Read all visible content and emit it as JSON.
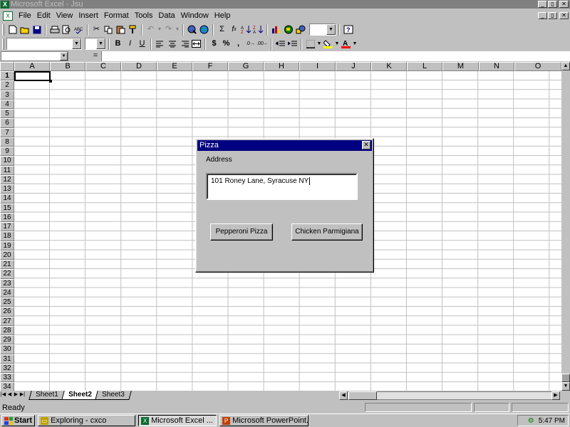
{
  "window": {
    "title": "Microsoft Excel - Jsu",
    "min_glyph": "_",
    "max_glyph": "▯",
    "close_glyph": "✕"
  },
  "menubar": {
    "items": [
      "File",
      "Edit",
      "View",
      "Insert",
      "Format",
      "Tools",
      "Data",
      "Window",
      "Help"
    ]
  },
  "toolbar": {
    "standard_icons": [
      "new-icon",
      "open-icon",
      "save-icon",
      "print-icon",
      "print-preview-icon",
      "spelling-icon",
      "cut-icon",
      "copy-icon",
      "paste-icon",
      "format-painter-icon",
      "undo-icon",
      "redo-icon",
      "hyperlink-icon",
      "web-toolbar-icon",
      "autosum-icon",
      "paste-function-icon",
      "sort-ascending-icon",
      "sort-descending-icon",
      "chart-wizard-icon",
      "map-icon",
      "drawing-icon",
      "zoom-box",
      "help-icon"
    ],
    "bold": "B",
    "italic": "I",
    "underline": "U",
    "currency": "$",
    "percent": "%",
    "comma": ",",
    "zoom_value": "",
    "font_name": "",
    "font_size": ""
  },
  "formula_bar": {
    "name_box": "",
    "equals": "=",
    "content": ""
  },
  "sheet": {
    "columns": [
      "A",
      "B",
      "C",
      "D",
      "E",
      "F",
      "G",
      "H",
      "I",
      "J",
      "K",
      "L",
      "M",
      "N",
      "O"
    ],
    "rows": [
      "1",
      "2",
      "3",
      "4",
      "5",
      "6",
      "7",
      "8",
      "9",
      "10",
      "11",
      "12",
      "13",
      "14",
      "15",
      "16",
      "17",
      "18",
      "19",
      "20",
      "21",
      "22",
      "23",
      "24",
      "25",
      "26",
      "27",
      "28",
      "29",
      "30",
      "31",
      "32",
      "33",
      "34"
    ],
    "active_cell": "A1"
  },
  "tabs": {
    "sheets": [
      "Sheet1",
      "Sheet2",
      "Sheet3"
    ],
    "active": "Sheet2"
  },
  "status": {
    "text": "Ready"
  },
  "dialog": {
    "title": "Pizza",
    "label": "Address",
    "input_value": "101 Roney Lane, Syracuse NY",
    "button_pepperoni": "Pepperoni Pizza",
    "button_chicken": "Chicken Parmigiana"
  },
  "taskbar": {
    "start": "Start",
    "items": [
      {
        "label": "Exploring - cxco",
        "icon": "explorer-icon",
        "pressed": false
      },
      {
        "label": "Microsoft Excel ...",
        "icon": "excel-icon",
        "pressed": true
      },
      {
        "label": "Microsoft PowerPoint...",
        "icon": "powerpoint-icon",
        "pressed": false
      }
    ],
    "clock": "5:47 PM"
  },
  "colors": {
    "title_active": "#000080",
    "title_inactive": "#808080",
    "face": "#c0c0c0",
    "gridline": "#c0c0c0"
  }
}
